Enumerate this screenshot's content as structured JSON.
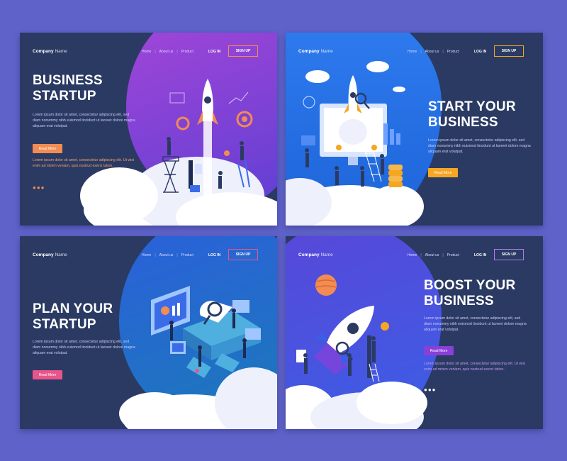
{
  "colors": {
    "background": "#5f63c9",
    "panel": "#2b3a63",
    "orange": "#f28c52",
    "purple": "#8a3fd8",
    "blue": "#3b6ce8",
    "teal": "#1b5fb5",
    "yellow": "#f5a623",
    "pink": "#e8558a"
  },
  "nav": {
    "company_bold": "Company",
    "company_rest": "Name",
    "links": [
      "Home",
      "About us",
      "Product"
    ],
    "login": "LOG IN",
    "signup": "SIGN UP"
  },
  "panels": [
    {
      "headline_1": "BUSINESS",
      "headline_2": "STARTUP",
      "body": "Lorem ipsum dolor sit amet, consectetur adipiscing elit, sed diam nonummy nibh euismod tincidunt ut laoreet dolore magna aliquam erat volutpat.",
      "button": "Read More",
      "body2": "Lorem ipsum dolor sit amet, consectetur adipiscing elit. Ut wisi enim ad minim veniam, quis nostrud exerci tation.",
      "dots": "●●●"
    },
    {
      "headline_1": "START YOUR",
      "headline_2": "BUSINESS",
      "body": "Lorem ipsum dolor sit amet, consectetur adipiscing elit, sed diam nonummy nibh euismod tincidunt ut laoreet dolore magna aliquam erat volutpat.",
      "button": "Read More"
    },
    {
      "headline_1": "PLAN YOUR",
      "headline_2": "STARTUP",
      "body": "Lorem ipsum dolor sit amet, consectetur adipiscing elit, sed diam nonummy nibh euismod tincidunt ut laoreet dolore magna aliquam erat volutpat.",
      "button": "Read More"
    },
    {
      "headline_1": "BOOST YOUR",
      "headline_2": "BUSINESS",
      "body": "Lorem ipsum dolor sit amet, consectetur adipiscing elit, sed diam nonummy nibh euismod tincidunt ut laoreet dolore magna aliquam erat volutpat.",
      "button": "Read More",
      "body2": "Lorem ipsum dolor sit amet, consectetur adipiscing elit. Ut wisi enim ad minim veniam, quis nostrud exerci tation.",
      "dots": "●●●"
    }
  ]
}
